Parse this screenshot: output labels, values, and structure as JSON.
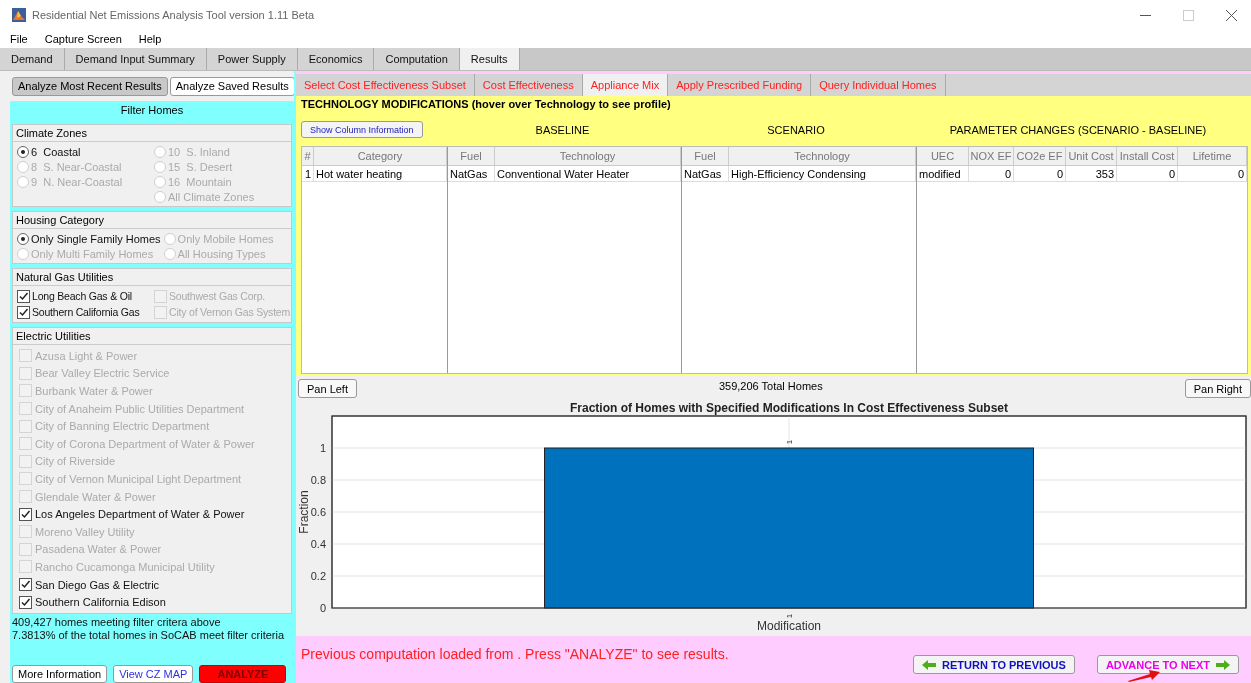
{
  "window": {
    "title": "Residential Net Emissions Analysis Tool version 1.11 Beta"
  },
  "menu": [
    "File",
    "Capture Screen",
    "Help"
  ],
  "tabs": [
    {
      "label": "Demand",
      "selected": false
    },
    {
      "label": "Demand Input Summary",
      "selected": false
    },
    {
      "label": "Power Supply",
      "selected": false
    },
    {
      "label": "Economics",
      "selected": false
    },
    {
      "label": "Computation",
      "selected": false
    },
    {
      "label": "Results",
      "selected": true
    }
  ],
  "left_panel": {
    "mode_buttons": [
      {
        "label": "Analyze Most Recent Results",
        "selected": true
      },
      {
        "label": "Analyze Saved Results",
        "selected": false
      }
    ],
    "filter_title": "Filter Homes",
    "climate_zones": {
      "title": "Climate Zones",
      "columns": [
        [
          {
            "label": "6  Coastal",
            "selected": true,
            "disabled": false
          },
          {
            "label": "8  S. Near-Coastal",
            "selected": false,
            "disabled": true
          },
          {
            "label": "9  N. Near-Coastal",
            "selected": false,
            "disabled": true
          }
        ],
        [
          {
            "label": "10  S. Inland",
            "selected": false,
            "disabled": true
          },
          {
            "label": "15  S. Desert",
            "selected": false,
            "disabled": true
          },
          {
            "label": "16  Mountain",
            "selected": false,
            "disabled": true
          },
          {
            "label": "All Climate Zones",
            "selected": false,
            "disabled": true
          }
        ]
      ]
    },
    "housing_category": {
      "title": "Housing Category",
      "columns": [
        [
          {
            "label": "Only Single Family Homes",
            "selected": true,
            "disabled": false
          },
          {
            "label": "Only Multi Family Homes",
            "selected": false,
            "disabled": true
          }
        ],
        [
          {
            "label": "Only Mobile Homes",
            "selected": false,
            "disabled": true
          },
          {
            "label": "All Housing Types",
            "selected": false,
            "disabled": true
          }
        ]
      ]
    },
    "gas_utilities": {
      "title": "Natural Gas Utilities",
      "columns": [
        [
          {
            "label": "Long Beach Gas & Oil",
            "checked": true,
            "disabled": false
          },
          {
            "label": "Southern California Gas",
            "checked": true,
            "disabled": false
          }
        ],
        [
          {
            "label": "Southwest Gas Corp.",
            "checked": false,
            "disabled": true
          },
          {
            "label": "City of Vernon Gas System",
            "checked": false,
            "disabled": true
          }
        ]
      ]
    },
    "electric_utilities": {
      "title": "Electric Utilities",
      "items": [
        {
          "label": "Azusa Light & Power",
          "checked": false,
          "disabled": true
        },
        {
          "label": "Bear Valley Electric Service",
          "checked": false,
          "disabled": true
        },
        {
          "label": "Burbank Water & Power",
          "checked": false,
          "disabled": true
        },
        {
          "label": "City of Anaheim Public Utilities Department",
          "checked": false,
          "disabled": true
        },
        {
          "label": "City of Banning Electric Department",
          "checked": false,
          "disabled": true
        },
        {
          "label": "City of Corona Department of Water & Power",
          "checked": false,
          "disabled": true
        },
        {
          "label": "City of Riverside",
          "checked": false,
          "disabled": true
        },
        {
          "label": "City of Vernon Municipal Light Department",
          "checked": false,
          "disabled": true
        },
        {
          "label": "Glendale Water & Power",
          "checked": false,
          "disabled": true
        },
        {
          "label": "Los Angeles Department of Water & Power",
          "checked": true,
          "disabled": false
        },
        {
          "label": "Moreno Valley Utility",
          "checked": false,
          "disabled": true
        },
        {
          "label": "Pasadena Water & Power",
          "checked": false,
          "disabled": true
        },
        {
          "label": "Rancho Cucamonga Municipal Utility",
          "checked": false,
          "disabled": true
        },
        {
          "label": "San Diego Gas & Electric",
          "checked": true,
          "disabled": false
        },
        {
          "label": "Southern California Edison",
          "checked": true,
          "disabled": false
        }
      ]
    },
    "summary": [
      "409,427 homes meeting filter critera above",
      "7.3813% of the total homes in SoCAB meet filter criteria"
    ],
    "buttons": [
      {
        "label": "More Information",
        "kind": "plain"
      },
      {
        "label": "View CZ MAP",
        "kind": "link"
      },
      {
        "label": "ANALYZE",
        "kind": "alert"
      }
    ]
  },
  "subtabs": [
    {
      "label": "Select Cost Effectiveness Subset",
      "selected": false
    },
    {
      "label": "Cost Effectiveness",
      "selected": false
    },
    {
      "label": "Appliance Mix",
      "selected": true
    },
    {
      "label": "Apply Prescribed Funding",
      "selected": false
    },
    {
      "label": "Query Individual Homes",
      "selected": false
    }
  ],
  "technology": {
    "title": "TECHNOLOGY MODIFICATIONS (hover over Technology to see profile)",
    "show_button": "Show Column Information",
    "table": {
      "sections": [
        {
          "columns": [
            "#",
            "Category"
          ]
        },
        {
          "heading": "BASELINE",
          "columns": [
            "Fuel",
            "Technology"
          ]
        },
        {
          "heading": "SCENARIO",
          "columns": [
            "Fuel",
            "Technology"
          ]
        },
        {
          "heading": "PARAMETER CHANGES (SCENARIO - BASELINE)",
          "columns": [
            "UEC",
            "NOX EF",
            "CO2e EF",
            "Unit Cost",
            "Install Cost",
            "Lifetime"
          ]
        }
      ],
      "rows": [
        [
          "1",
          "Hot water heating",
          "NatGas",
          "Conventional Water Heater",
          "NatGas",
          "High-Efficiency Condensing",
          "modified",
          "0",
          "0",
          "353",
          "0",
          "0"
        ]
      ]
    }
  },
  "chart": {
    "total_homes": "359,206 Total Homes",
    "pan_left": "Pan Left",
    "pan_right": "Pan Right",
    "chart_data": {
      "type": "bar",
      "title": "Fraction of Homes with Specified Modifications In Cost Effectiveness Subset",
      "xlabel": "Modification",
      "ylabel": "Fraction",
      "categories": [
        "1"
      ],
      "series": [
        {
          "color": "#0072bd",
          "values": [
            1
          ]
        }
      ],
      "grid": true,
      "ylim": [
        0,
        1.2
      ],
      "yticks": [
        0,
        0.2,
        0.4,
        0.6,
        0.8,
        1
      ],
      "data_labels": true
    }
  },
  "status": {
    "message": "Previous computation loaded from . Press \"ANALYZE\" to see results.",
    "nav": [
      {
        "label": "RETURN TO PREVIOUS",
        "kind": "back",
        "highlighted": false
      },
      {
        "label": "ADVANCE TO NEXT",
        "kind": "forward",
        "highlighted": true
      }
    ]
  }
}
